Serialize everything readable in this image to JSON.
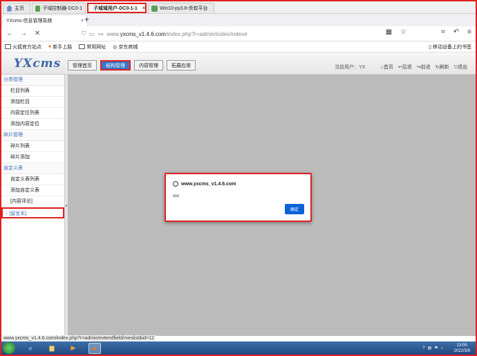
{
  "host_tabs": [
    {
      "label": "主页"
    },
    {
      "label": "子域控制器-DC0-1"
    },
    {
      "label": "子域域用户-DC0-1-1"
    },
    {
      "label": "Win10-py3.8-杀软平台"
    }
  ],
  "browser": {
    "tab_title": "YXcms-信息管理系统",
    "url_prefix": "www.",
    "url_domain": "yxcms_v1.4.6.com",
    "url_path": "/index.php?r=admin/index/index#",
    "bookmarks": [
      "火狐官方站点",
      "新手上路",
      "常用网址",
      "京东商城"
    ],
    "mobile_bookmarks": "移动设备上的书签"
  },
  "app": {
    "logo": "YXcms",
    "menu": [
      "管理首页",
      "结构管理",
      "内容管理",
      "拓展应用"
    ],
    "current_user": "当前用户：YX",
    "toplinks": [
      "首页",
      "后退",
      "前进",
      "刷新",
      "退出"
    ]
  },
  "sidebar": {
    "sections": [
      {
        "title": "分类管理",
        "items": [
          "栏目列表",
          "添加栏目",
          "内容定位列表",
          "添加内容定位"
        ]
      },
      {
        "title": "碎片管理",
        "items": [
          "碎片列表",
          "碎片添加"
        ]
      },
      {
        "title": "自定义表",
        "items": [
          "自定义表列表",
          "添加自定义表",
          "[内容评论]",
          "[留言本]"
        ]
      }
    ]
  },
  "dialog": {
    "title": "www.yxcms_v1.4.6.com",
    "message": "xss",
    "ok_label": "确定"
  },
  "status_url": "www.yxcms_v1.4.6.com/index.php?r=admin/extendfield/meslist&id=12",
  "taskbar": {
    "time": "13:00",
    "date": "2022/3/9"
  }
}
